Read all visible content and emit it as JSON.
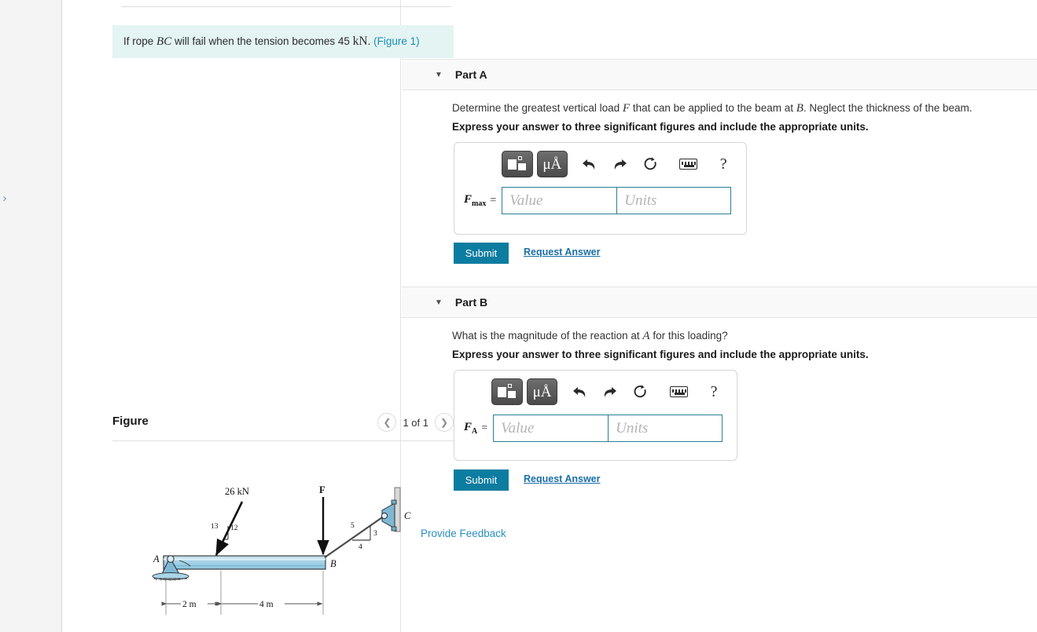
{
  "problem": {
    "text_before": "If rope",
    "rope": "BC",
    "text_mid": "will fail when the tension becomes 45",
    "unit": "kN",
    "period": ".",
    "figure_link": "(Figure 1)"
  },
  "figure_panel": {
    "title": "Figure",
    "prev_icon": "chevron-left-icon",
    "next_icon": "chevron-right-icon",
    "counter": "1 of 1"
  },
  "gutter": {
    "toggle_icon": "chevron-right-icon"
  },
  "parts": [
    {
      "id": "part-a",
      "label": "Part A",
      "caret": "▼",
      "question": "Determine the greatest vertical load F that can be applied to the beam at B. Neglect the thickness of the beam.",
      "question_pre": "Determine the greatest vertical load",
      "question_var1": "F",
      "question_mid": "that can be applied to the beam at",
      "question_var2": "B",
      "question_post": ". Neglect the thickness of the beam.",
      "instruction": "Express your answer to three significant figures and include the appropriate units.",
      "answer_label": "F",
      "answer_sub": "max",
      "equals": "=",
      "value_placeholder": "Value",
      "units_placeholder": "Units",
      "value": "",
      "units": "",
      "submit_label": "Submit",
      "request_label": "Request Answer"
    },
    {
      "id": "part-b",
      "label": "Part B",
      "caret": "▼",
      "question": "What is the magnitude of the reaction at A for this loading?",
      "question_pre": "What is the magnitude of the reaction at",
      "question_var1": "A",
      "question_post": "for this loading?",
      "instruction": "Express your answer to three significant figures and include the appropriate units.",
      "answer_label": "F",
      "answer_sub": "A",
      "equals": "=",
      "value_placeholder": "Value",
      "units_placeholder": "Units",
      "value": "",
      "units": "",
      "submit_label": "Submit",
      "request_label": "Request Answer"
    }
  ],
  "toolbar": {
    "template_icon": "math-template-icon",
    "units_label": "μÅ",
    "units_icon": "units-icon",
    "undo_icon": "undo-arrow-icon",
    "redo_icon": "redo-arrow-icon",
    "reset_icon": "reset-circular-arrow-icon",
    "keyboard_icon": "keyboard-icon",
    "help_label": "?",
    "help_icon": "help-question-icon"
  },
  "feedback": {
    "label": "Provide Feedback"
  },
  "diagram": {
    "load_label": "26 kN",
    "force_label": "F",
    "point_a": "A",
    "point_b": "B",
    "point_c": "C",
    "load_slope_hyp": "13",
    "load_slope_vert": "12",
    "load_slope_horz": "5",
    "rope_slope_hyp": "5",
    "rope_slope_vert": "3",
    "rope_slope_horz": "4",
    "dim_left": "2 m",
    "dim_right": "4 m",
    "beam_color": "#a9d5e8",
    "support_color": "#7fb8d4"
  },
  "colors": {
    "accent_teal": "#0c7ca0",
    "link_blue": "#1a6ea8",
    "problem_bg": "#e4f4f3",
    "part_header_bg": "#f9f9f9"
  }
}
